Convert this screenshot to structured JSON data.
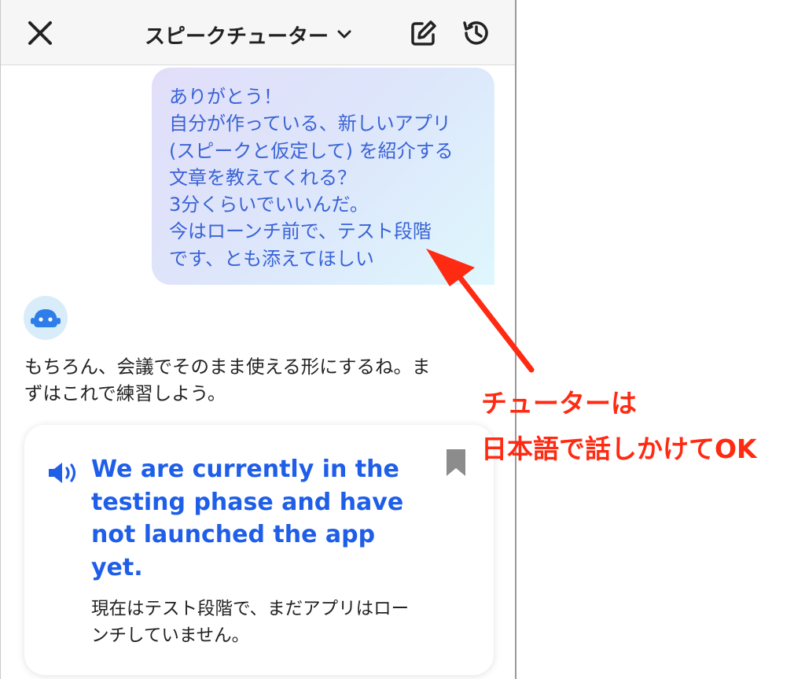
{
  "header": {
    "close_icon": "close-icon",
    "title": "スピークチューター",
    "title_dropdown_icon": "chevron-down-icon",
    "new_chat_icon": "edit-icon",
    "history_icon": "history-icon"
  },
  "user_message": {
    "lines": [
      "ありがとう！",
      "自分が作っている、新しいアプリ",
      "(スピークと仮定して) を紹介する",
      "文章を教えてくれる？",
      "3分くらいでいいんだ。",
      "今はローンチ前で、テスト段階",
      "です、とも添えてほしい"
    ]
  },
  "tutor": {
    "avatar_icon": "tutor-avatar-icon",
    "message_lines": [
      "もちろん、会議でそのまま使える形にするね。ま",
      "ずはこれで練習しよう。"
    ]
  },
  "phrase_card": {
    "speaker_icon": "speaker-icon",
    "bookmark_icon": "bookmark-icon",
    "english_lines": [
      "We are currently in the",
      "testing phase and have",
      "not launched the app",
      "yet."
    ],
    "translation_lines": [
      "現在はテスト段階で、まだアプリはロー",
      "ンチしていません。"
    ]
  },
  "annotation": {
    "lines": [
      "チューターは",
      "日本語で話しかけてOK"
    ]
  },
  "colors": {
    "accent_blue": "#1e5ee8",
    "user_text": "#3a63d6",
    "annotation_red": "#ff2a12"
  }
}
